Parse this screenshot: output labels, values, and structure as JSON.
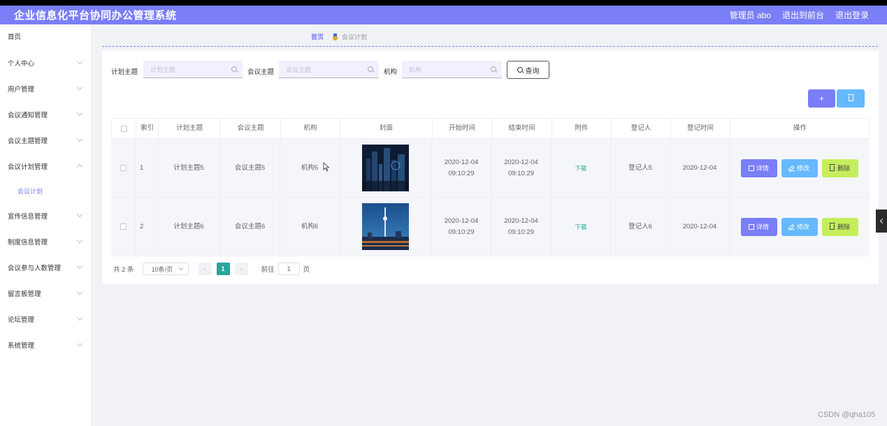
{
  "header": {
    "title": "企业信息化平台协同办公管理系统",
    "user": "管理员 abo",
    "front": "退出到前台",
    "logout": "退出登录"
  },
  "sidebar": {
    "items": [
      {
        "label": "首页"
      },
      {
        "label": "个人中心"
      },
      {
        "label": "用户管理"
      },
      {
        "label": "会议通知管理"
      },
      {
        "label": "会议主题管理"
      },
      {
        "label": "会议计划管理"
      },
      {
        "label": "宣传信息管理"
      },
      {
        "label": "制度信息管理"
      },
      {
        "label": "会议参与人数管理"
      },
      {
        "label": "留言板管理"
      },
      {
        "label": "论坛管理"
      },
      {
        "label": "系统管理"
      }
    ],
    "sub": "会议计划"
  },
  "breadcrumb": {
    "home": "首页",
    "current": "会议计划"
  },
  "filters": {
    "f1_label": "计划主题",
    "f1_ph": "计划主题",
    "f2_label": "会议主题",
    "f2_ph": "会议主题",
    "f3_label": "机构",
    "f3_ph": "机构",
    "search": "查询"
  },
  "toolbar": {
    "add": "+"
  },
  "table": {
    "headers": [
      "索引",
      "计划主题",
      "会议主题",
      "机构",
      "封面",
      "开始时间",
      "结束时间",
      "附件",
      "登记人",
      "登记时间",
      "操作"
    ],
    "rows": [
      {
        "idx": "1",
        "plan": "计划主题5",
        "topic": "会议主题5",
        "org": "机构5",
        "start": "2020-12-04 09:10:29",
        "end": "2020-12-04 09:10:29",
        "file": "下载",
        "person": "登记人5",
        "date": "2020-12-04"
      },
      {
        "idx": "2",
        "plan": "计划主题6",
        "topic": "会议主题6",
        "org": "机构6",
        "start": "2020-12-04 09:10:29",
        "end": "2020-12-04 09:10:29",
        "file": "下载",
        "person": "登记人6",
        "date": "2020-12-04"
      }
    ],
    "actions": {
      "detail": "详情",
      "edit": "修改",
      "remove": "删除"
    }
  },
  "pager": {
    "total": "共 2 条",
    "size": "10条/页",
    "page": "1",
    "goto": "前往",
    "goto_val": "1",
    "unit": "页",
    "prev": "‹",
    "next": "›"
  },
  "watermark": "CSDN @qha105",
  "colors": {
    "accent": "#7a7ef7",
    "info": "#66b9ff",
    "warning": "#c5ee5a",
    "page": "#26a69a"
  }
}
